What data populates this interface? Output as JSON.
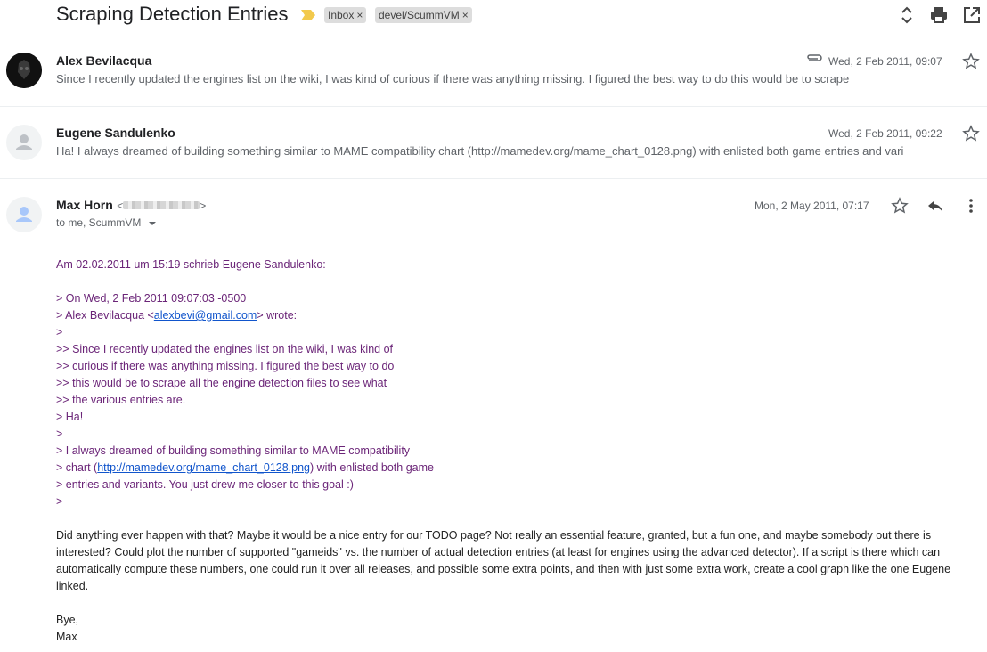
{
  "header": {
    "subject": "Scraping Detection Entries",
    "labels": [
      {
        "name": "Inbox",
        "remove": "×"
      },
      {
        "name": "devel/ScummVM",
        "remove": "×"
      }
    ]
  },
  "messages": [
    {
      "sender": "Alex Bevilacqua",
      "date": "Wed, 2 Feb 2011, 09:07",
      "snippet": "Since I recently updated the engines list on the wiki, I was kind of curious if there was anything missing. I figured the best way to do this would be to scrape",
      "has_attachment": true
    },
    {
      "sender": "Eugene Sandulenko",
      "date": "Wed, 2 Feb 2011, 09:22",
      "snippet": "Ha! I always dreamed of building something similar to MAME compatibility chart (http://mamedev.org/mame_chart_0128.png) with enlisted both game entries and vari"
    }
  ],
  "expanded": {
    "sender": "Max Horn",
    "email_open": "<",
    "email_close": ">",
    "recipients": "to me, ScummVM",
    "date": "Mon, 2 May 2011, 07:17",
    "quote_intro": "Am 02.02.2011 um 15:19 schrieb Eugene Sandulenko:",
    "quote_lines": [
      "> On Wed, 2 Feb 2011 09:07:03 -0500",
      "> Alex Bevilacqua <",
      "alexbevi@gmail.com",
      "> wrote:",
      ">",
      ">> Since I recently updated the engines list on the wiki, I was kind of",
      ">> curious if there was anything missing. I figured the best way to do",
      ">> this would be to scrape all the engine detection files to see what",
      ">> the various entries are.",
      "> Ha!",
      ">",
      "> I always dreamed of building something similar to MAME compatibility",
      "> chart (",
      "http://mamedev.org/mame_chart_0128.png",
      ") with enlisted both game",
      "> entries and variants. You just drew me closer to this goal :)",
      ">"
    ],
    "body_paragraph": "Did anything ever happen with that? Maybe it would be a nice entry for our TODO page? Not really an essential feature, granted, but a fun one, and maybe somebody out there is interested? Could plot the number of supported \"gameids\" vs. the number of actual detection entries (at least for engines using the advanced detector). If a script is there which can automatically compute these numbers, one could run it over all releases, and possible some extra points, and then with just some extra work, create a cool graph like the one Eugene linked.",
    "signoff": "Bye,",
    "signature": "Max"
  },
  "colors": {
    "quote": "#6b2578",
    "link": "#1155cc",
    "label_bg": "#dddddd",
    "importance_marker": "#f2c94c"
  }
}
